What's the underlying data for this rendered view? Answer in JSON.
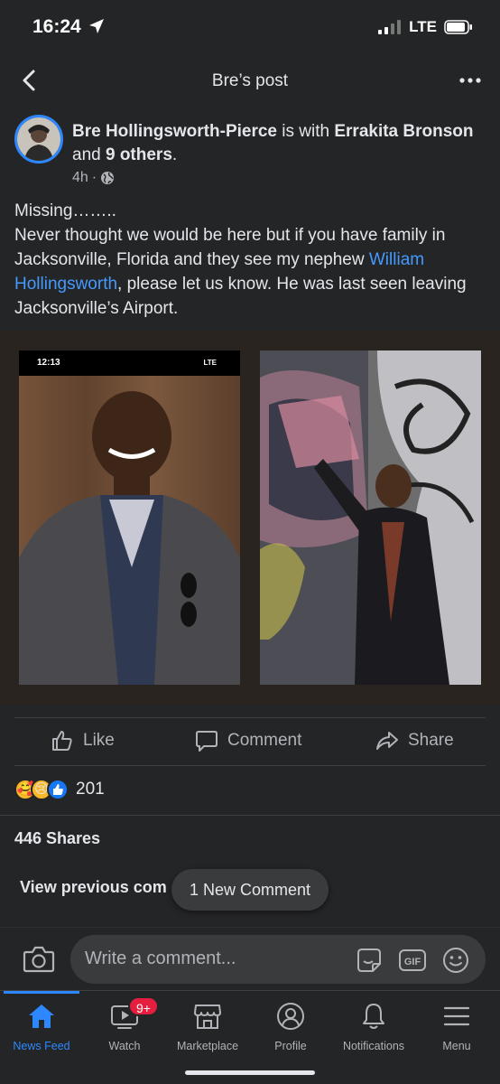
{
  "status_bar": {
    "time": "16:24",
    "network": "LTE"
  },
  "nav": {
    "title": "Bre’s post"
  },
  "post": {
    "author": "Bre Hollingsworth-Pierce",
    "with_text": " is with ",
    "tagged": "Errakita Bronson",
    "and_text": " and ",
    "others": "9 others",
    "period": ".",
    "time": "4h",
    "dot": "·",
    "text_line1": "Missing……..",
    "text_part1": "Never thought we would be here but if you have family in Jacksonville, Florida and they see my nephew ",
    "mention": "William Hollingsworth",
    "text_part2": ", please let us know. He was last seen leaving Jacksonville’s Airport."
  },
  "photo_left": {
    "time": "12:13",
    "network": "LTE"
  },
  "actions": {
    "like": "Like",
    "comment": "Comment",
    "share": "Share"
  },
  "reactions": {
    "count": "201"
  },
  "shares": {
    "label": "446 Shares"
  },
  "comments": {
    "view_previous": "View previous com",
    "new_comment": "1 New Comment",
    "placeholder": "Write a comment..."
  },
  "tabs": [
    {
      "label": "News Feed"
    },
    {
      "label": "Watch",
      "badge": "9+"
    },
    {
      "label": "Marketplace"
    },
    {
      "label": "Profile"
    },
    {
      "label": "Notifications"
    },
    {
      "label": "Menu"
    }
  ],
  "colors": {
    "accent": "#2d88ff",
    "link": "#4599ff",
    "badge": "#e41e3f",
    "background": "#242526"
  }
}
